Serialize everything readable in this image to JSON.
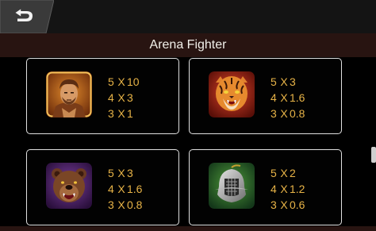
{
  "header": {
    "back_icon": "back-arrow-icon",
    "title": "Arena Fighter"
  },
  "paytable": [
    {
      "symbol": "gladiator",
      "icon": "gladiator-symbol-icon",
      "rows": [
        {
          "count": "5",
          "x": "X",
          "multiplier": "10"
        },
        {
          "count": "4",
          "x": "X",
          "multiplier": "3"
        },
        {
          "count": "3",
          "x": "X",
          "multiplier": "1"
        }
      ]
    },
    {
      "symbol": "tiger",
      "icon": "tiger-symbol-icon",
      "rows": [
        {
          "count": "5",
          "x": "X",
          "multiplier": "3"
        },
        {
          "count": "4",
          "x": "X",
          "multiplier": "1.6"
        },
        {
          "count": "3",
          "x": "X",
          "multiplier": "0.8"
        }
      ]
    },
    {
      "symbol": "bear",
      "icon": "bear-symbol-icon",
      "rows": [
        {
          "count": "5",
          "x": "X",
          "multiplier": "3"
        },
        {
          "count": "4",
          "x": "X",
          "multiplier": "1.6"
        },
        {
          "count": "3",
          "x": "X",
          "multiplier": "0.8"
        }
      ]
    },
    {
      "symbol": "helmet",
      "icon": "helmet-symbol-icon",
      "rows": [
        {
          "count": "5",
          "x": "X",
          "multiplier": "2"
        },
        {
          "count": "4",
          "x": "X",
          "multiplier": "1.2"
        },
        {
          "count": "3",
          "x": "X",
          "multiplier": "0.6"
        }
      ]
    }
  ],
  "colors": {
    "payout_text": "#e7b347",
    "title_bar": "#281411",
    "card_border": "#e0e0e0"
  }
}
